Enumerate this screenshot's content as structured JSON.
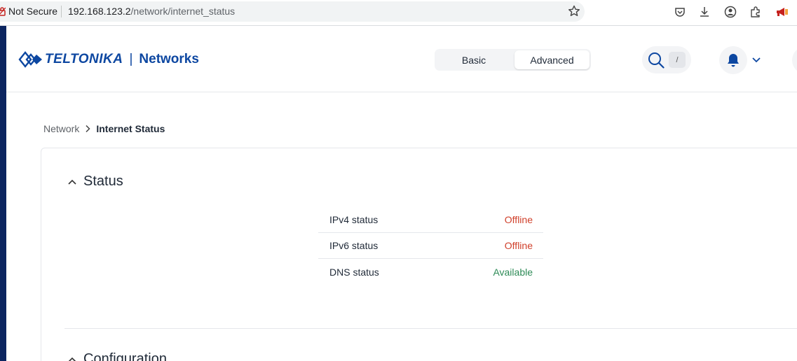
{
  "browser": {
    "security_label": "Not Secure",
    "url_host": "192.168.123.2",
    "url_path": "/network/internet_status"
  },
  "header": {
    "logo_text": "TELTONIKA",
    "logo_product": "Networks",
    "mode_basic": "Basic",
    "mode_advanced": "Advanced",
    "mode_selected": "Advanced",
    "search_shortcut": "/"
  },
  "breadcrumb": {
    "parent": "Network",
    "current": "Internet Status"
  },
  "status_section": {
    "title": "Status",
    "rows": [
      {
        "label": "IPv4 status",
        "value": "Offline",
        "state": "offline"
      },
      {
        "label": "IPv6 status",
        "value": "Offline",
        "state": "offline"
      },
      {
        "label": "DNS status",
        "value": "Available",
        "state": "available"
      }
    ]
  },
  "config_section": {
    "title": "Configuration"
  },
  "colors": {
    "brand": "#0d47a1",
    "offline": "#d0402b",
    "available": "#2e8b57",
    "sidebar_strip": "#0c2560"
  }
}
